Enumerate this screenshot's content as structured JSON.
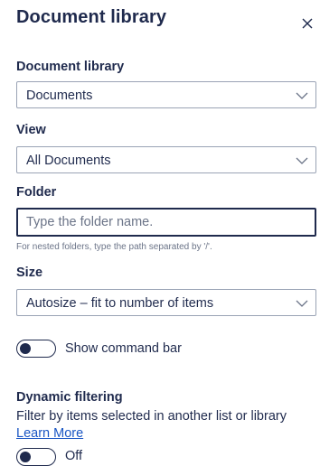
{
  "panel": {
    "title": "Document library",
    "close_icon": "close-icon"
  },
  "document_library": {
    "label": "Document library",
    "selected": "Documents"
  },
  "view": {
    "label": "View",
    "selected": "All Documents"
  },
  "folder": {
    "label": "Folder",
    "value": "",
    "placeholder": "Type the folder name.",
    "helper": "For nested folders, type the path separated by '/'."
  },
  "size": {
    "label": "Size",
    "selected": "Autosize – fit to number of items"
  },
  "command_bar_toggle": {
    "label": "Show command bar",
    "on": false
  },
  "dynamic_filtering": {
    "title": "Dynamic filtering",
    "description": "Filter by items selected in another list or library",
    "link_text": "Learn More",
    "toggle_state_label": "Off",
    "on": false
  },
  "colors": {
    "text": "#1f2a4d",
    "link": "#1a56c4",
    "border": "#9aa3b5",
    "muted": "#6b7488"
  }
}
